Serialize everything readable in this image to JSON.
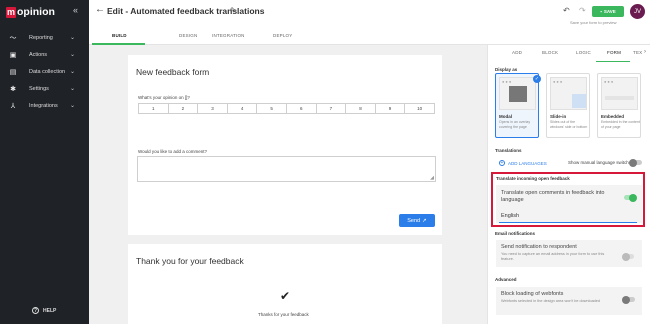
{
  "sidebar": {
    "brand_letter": "m",
    "brand_rest": "opinion",
    "collapse_glyph": "«",
    "items": [
      {
        "label": "Reporting",
        "icon": "reporting-icon",
        "glyph": "〜"
      },
      {
        "label": "Actions",
        "icon": "actions-icon",
        "glyph": "▣"
      },
      {
        "label": "Data collection",
        "icon": "data-collection-icon",
        "glyph": "▤"
      },
      {
        "label": "Settings",
        "icon": "gear-icon",
        "glyph": "✱"
      },
      {
        "label": "Integrations",
        "icon": "integrations-icon",
        "glyph": "⅄"
      }
    ],
    "help_label": "HELP",
    "help_glyph": "?"
  },
  "header": {
    "back_glyph": "←",
    "title": "Edit - Automated feedback translations",
    "pencil_glyph": "✎",
    "undo_glyph": "↶",
    "redo_glyph": "↷",
    "save_label": "SAVE",
    "save_hint": "Save your form to preview",
    "avatar_initials": "JV"
  },
  "tabs": [
    "BUILD",
    "DESIGN",
    "INTEGRATION",
    "DEPLOY"
  ],
  "form": {
    "title": "New feedback form",
    "q1": "What's your opinion on []?",
    "scale": [
      "1",
      "2",
      "3",
      "4",
      "5",
      "6",
      "7",
      "8",
      "9",
      "10"
    ],
    "q2": "Would you like to add a comment?",
    "send_label": "Send",
    "thanks_title": "Thank you for your feedback",
    "thanks_text": "Thanks for your feedback"
  },
  "panel": {
    "tabs": [
      "ADD",
      "BLOCK",
      "LOGIC",
      "FORM",
      "TEX"
    ],
    "active_tab": "FORM",
    "display_as": "Display as",
    "display_options": [
      {
        "title": "Modal",
        "desc": "Opens in an overlay covering the page"
      },
      {
        "title": "Slide-in",
        "desc": "Slides out of the windows' side or bottom"
      },
      {
        "title": "Embedded",
        "desc": "Embedded in the content of your page"
      }
    ],
    "translations": "Translations",
    "add_languages": "ADD LANGUAGES",
    "show_manual": "Show manual language switch",
    "translate_section": "Translate incoming open feedback",
    "translate_text": "Translate open comments in feedback into language",
    "language_value": "English",
    "email_section": "Email notifications",
    "email_title": "Send notification to respondent",
    "email_desc": "You need to capture an email address in your form to use this feature.",
    "advanced_section": "Advanced",
    "block_title": "Block loading of webfonts",
    "block_desc": "Webfonts selected in the design area won't be downloaded"
  },
  "colors": {
    "accent_green": "#3bb75e",
    "brand_red": "#d6193a",
    "link_blue": "#2b7de9",
    "sidebar_bg": "#1f2227"
  }
}
